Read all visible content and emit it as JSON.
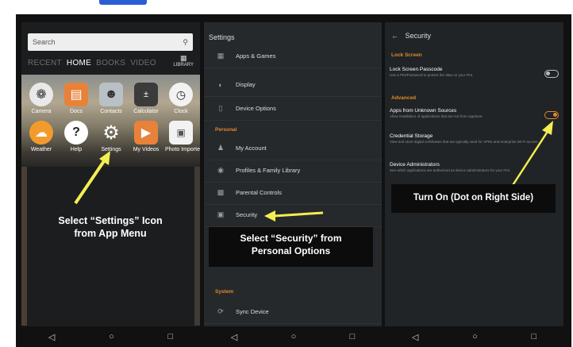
{
  "colors": {
    "accent": "#e0892b",
    "arrow": "#f4ee52",
    "topbar": "#2a5dd6"
  },
  "panel1": {
    "search_placeholder": "Search",
    "tabs": [
      "RECENT",
      "HOME",
      "BOOKS",
      "VIDEO"
    ],
    "active_tab": "HOME",
    "library_label": "LIBRARY",
    "apps_row1": [
      {
        "label": "Camera",
        "icon": "camera-icon"
      },
      {
        "label": "Docs",
        "icon": "docs-icon"
      },
      {
        "label": "Contacts",
        "icon": "contacts-icon"
      },
      {
        "label": "Calculator",
        "icon": "calculator-icon"
      },
      {
        "label": "Clock",
        "icon": "clock-icon"
      }
    ],
    "apps_row2": [
      {
        "label": "Weather",
        "icon": "weather-icon"
      },
      {
        "label": "Help",
        "icon": "help-icon"
      },
      {
        "label": "Settings",
        "icon": "gear-icon"
      },
      {
        "label": "My Videos",
        "icon": "play-icon"
      },
      {
        "label": "Photo Importer",
        "icon": "photo-importer-icon"
      }
    ],
    "callout_line1": "Select “Settings” Icon",
    "callout_line2": "from App Menu"
  },
  "panel2": {
    "title": "Settings",
    "items_top": [
      "Apps & Games",
      "Display",
      "Device Options"
    ],
    "section_personal": "Personal",
    "items_personal": [
      "My Account",
      "Profiles & Family Library",
      "Parental Controls",
      "Security"
    ],
    "section_system": "System",
    "items_system": [
      "Sync Device"
    ],
    "callout_line1": "Select “Security” from",
    "callout_line2": "Personal Options"
  },
  "panel3": {
    "title": "Security",
    "section_lock": "Lock Screen",
    "lock_title": "Lock Screen Passcode",
    "lock_desc": "Use a PIN/Password to protect the data on your Fire.",
    "section_advanced": "Advanced",
    "unknown_title": "Apps from Unknown Sources",
    "unknown_desc": "Allow installation of applications that are not from Appstore.",
    "cred_title": "Credential Storage",
    "cred_desc": "View and store digital certificates that are typically used for VPNs and enterprise Wi-Fi access.",
    "admin_title": "Device Administrators",
    "admin_desc": "See which applications are authorized as device administrators for your Fire.",
    "callout": "Turn On (Dot on Right Side)",
    "toggle_unknown_on": true,
    "toggle_lock_on": false
  },
  "nav": {
    "back": "◁",
    "home": "○",
    "recent": "□"
  }
}
